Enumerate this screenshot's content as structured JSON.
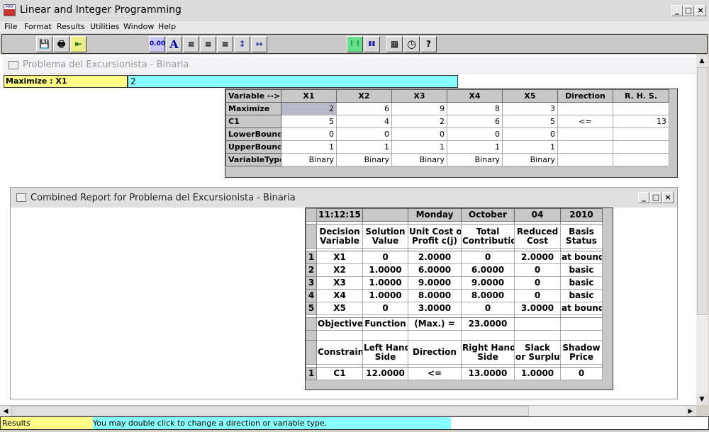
{
  "app": {
    "title": "Linear and Integer Programming",
    "icon": "app-icon",
    "window_controls": [
      "_",
      "□",
      "×"
    ]
  },
  "menu": [
    "File",
    "Format",
    "Results",
    "Utilities",
    "Window",
    "Help"
  ],
  "toolbar": {
    "buttons": [
      {
        "icon": "save-icon",
        "label": "💾"
      },
      {
        "icon": "print-icon",
        "label": "🖶"
      },
      {
        "icon": "exit-icon",
        "label": "⇤"
      },
      {
        "icon": "number-format-icon",
        "label": "0.00"
      },
      {
        "icon": "font-icon",
        "label": "A"
      },
      {
        "icon": "align-left-icon",
        "label": "≡"
      },
      {
        "icon": "align-center-icon",
        "label": "≡"
      },
      {
        "icon": "align-right-icon",
        "label": "≡"
      },
      {
        "icon": "row-height-icon",
        "label": "↕"
      },
      {
        "icon": "column-width-icon",
        "label": "↔"
      },
      {
        "icon": "grid-icon",
        "label": "⋮⋮"
      },
      {
        "icon": "chart-icon",
        "label": "▮▮"
      },
      {
        "icon": "calculator-icon",
        "label": "▦"
      },
      {
        "icon": "clock-icon",
        "label": "◷"
      },
      {
        "icon": "help-icon",
        "label": "?"
      }
    ]
  },
  "model_window": {
    "title": "Problema del Excursionista - Binaria",
    "cell_label": "Maximize : X1",
    "cell_value": "2",
    "headers": [
      "Variable -->",
      "X1",
      "X2",
      "X3",
      "X4",
      "X5",
      "Direction",
      "R. H. S."
    ],
    "rows": [
      {
        "label": "Maximize",
        "values": [
          "2",
          "6",
          "9",
          "8",
          "3"
        ],
        "direction": "",
        "rhs": ""
      },
      {
        "label": "C1",
        "values": [
          "5",
          "4",
          "2",
          "6",
          "5"
        ],
        "direction": "<=",
        "rhs": "13"
      },
      {
        "label": "LowerBound",
        "values": [
          "0",
          "0",
          "0",
          "0",
          "0"
        ],
        "direction": "",
        "rhs": ""
      },
      {
        "label": "UpperBound",
        "values": [
          "1",
          "1",
          "1",
          "1",
          "1"
        ],
        "direction": "",
        "rhs": ""
      },
      {
        "label": "VariableType",
        "values": [
          "Binary",
          "Binary",
          "Binary",
          "Binary",
          "Binary"
        ],
        "direction": "",
        "rhs": ""
      }
    ]
  },
  "report_window": {
    "title": "Combined Report for Problema del Excursionista - Binaria",
    "date_row": [
      "11:12:15",
      "",
      "Monday",
      "October",
      "04",
      "2010"
    ],
    "var_headers": [
      "Decision\nVariable",
      "Solution\nValue",
      "Unit Cost or\nProfit c(j)",
      "Total\nContribution",
      "Reduced\nCost",
      "Basis\nStatus"
    ],
    "variables": [
      {
        "n": "1",
        "cells": [
          "X1",
          "0",
          "2.0000",
          "0",
          "2.0000",
          "at bound"
        ]
      },
      {
        "n": "2",
        "cells": [
          "X2",
          "1.0000",
          "6.0000",
          "6.0000",
          "0",
          "basic"
        ]
      },
      {
        "n": "3",
        "cells": [
          "X3",
          "1.0000",
          "9.0000",
          "9.0000",
          "0",
          "basic"
        ]
      },
      {
        "n": "4",
        "cells": [
          "X4",
          "1.0000",
          "8.0000",
          "8.0000",
          "0",
          "basic"
        ]
      },
      {
        "n": "5",
        "cells": [
          "X5",
          "0",
          "3.0000",
          "0",
          "3.0000",
          "at bound"
        ]
      }
    ],
    "objective": [
      "Objective",
      "Function",
      "(Max.) =",
      "23.0000",
      "",
      ""
    ],
    "con_headers": [
      "Constraint",
      "Left Hand\nSide",
      "Direction",
      "Right Hand\nSide",
      "Slack\nor Surplus",
      "Shadow\nPrice"
    ],
    "constraints": [
      {
        "n": "1",
        "cells": [
          "C1",
          "12.0000",
          "<=",
          "13.0000",
          "1.0000",
          "0"
        ]
      }
    ]
  },
  "status": {
    "label": "Results",
    "message": "You may double click to change a direction or variable type."
  }
}
